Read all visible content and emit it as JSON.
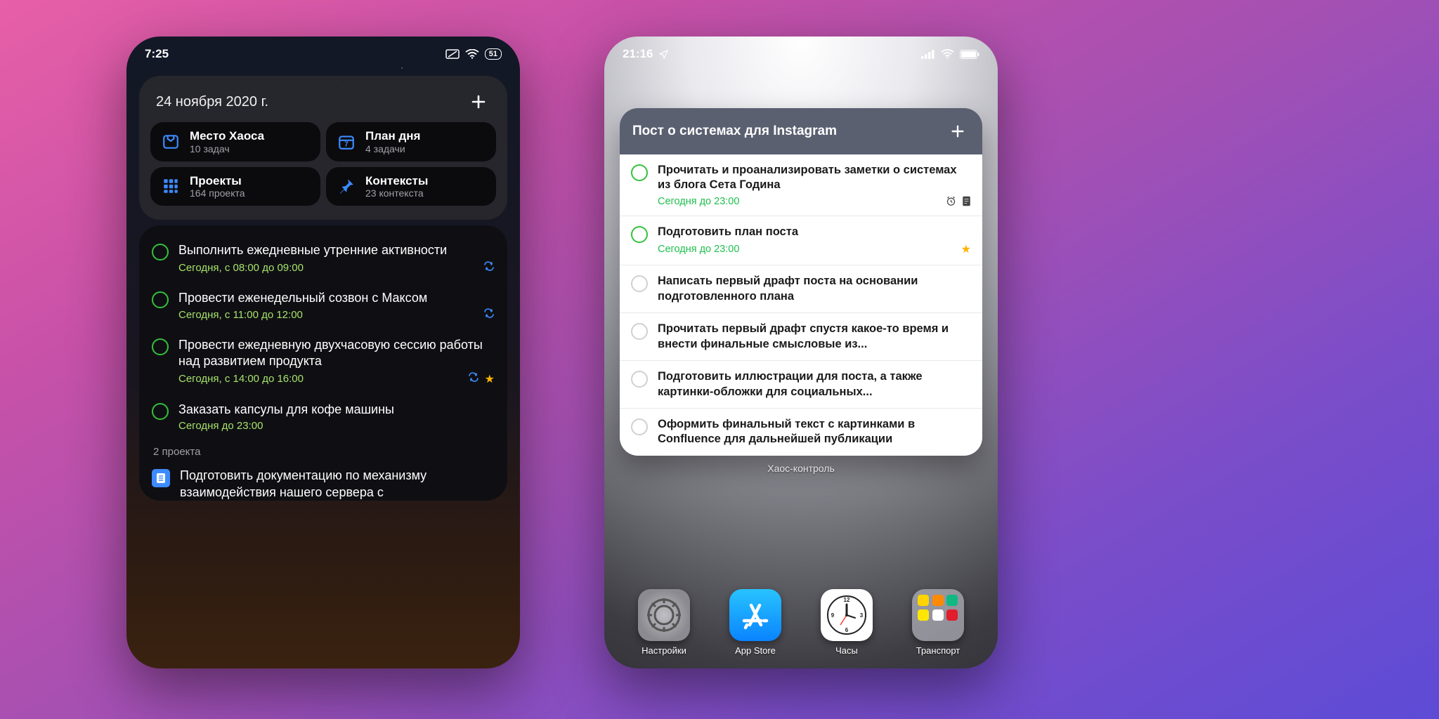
{
  "left": {
    "statusbar": {
      "time": "7:25",
      "battery": "51"
    },
    "widget": {
      "date": "24 ноября 2020 г.",
      "nav": [
        {
          "title": "Место Хаоса",
          "subtitle": "10 задач",
          "icon": "inbox-icon"
        },
        {
          "title": "План дня",
          "subtitle": "4 задачи",
          "icon": "calendar-icon"
        },
        {
          "title": "Проекты",
          "subtitle": "164 проекта",
          "icon": "grid-icon"
        },
        {
          "title": "Контексты",
          "subtitle": "23 контекста",
          "icon": "pin-icon"
        }
      ],
      "tasks": [
        {
          "title": "Выполнить ежедневные утренние активности",
          "when": "Сегодня, с 08:00 до 09:00",
          "repeat": true,
          "star": false
        },
        {
          "title": "Провести еженедельный созвон с Максом",
          "when": "Сегодня, с 11:00 до 12:00",
          "repeat": true,
          "star": false
        },
        {
          "title": "Провести ежедневную двухчасовую сессию работы над развитием продукта",
          "when": "Сегодня, с 14:00 до 16:00",
          "repeat": true,
          "star": true
        },
        {
          "title": "Заказать капсулы для кофе машины",
          "when": "Сегодня до 23:00",
          "repeat": false,
          "star": false
        }
      ],
      "section_label": "2 проекта",
      "project_title": "Подготовить документацию по механизму взаимодействия нашего сервера с"
    }
  },
  "right": {
    "statusbar": {
      "time": "21:16"
    },
    "widget": {
      "title": "Пост о системах для Instagram",
      "tasks": [
        {
          "title": "Прочитать и проанализировать заметки о системах из блога Сета Година",
          "when": "Сегодня до 23:00",
          "active": true,
          "alarm": true,
          "note": true,
          "star": false
        },
        {
          "title": "Подготовить план поста",
          "when": "Сегодня до 23:00",
          "active": true,
          "alarm": false,
          "note": false,
          "star": true
        },
        {
          "title": "Написать первый драфт поста на основании подготовленного плана",
          "when": "",
          "active": false
        },
        {
          "title": "Прочитать первый драфт спустя какое-то время и внести финальные смысловые из...",
          "when": "",
          "active": false
        },
        {
          "title": "Подготовить иллюстрации для поста, а также картинки-обложки для социальных...",
          "when": "",
          "active": false
        },
        {
          "title": "Оформить финальный текст с картинками в Confluence для дальнейшей публикации",
          "when": "",
          "active": false
        }
      ],
      "caption": "Хаос-контроль"
    },
    "dock": [
      {
        "label": "Настройки",
        "icon": "settings-app-icon"
      },
      {
        "label": "App Store",
        "icon": "appstore-app-icon"
      },
      {
        "label": "Часы",
        "icon": "clock-app-icon"
      },
      {
        "label": "Транспорт",
        "icon": "transport-folder-icon"
      }
    ]
  }
}
